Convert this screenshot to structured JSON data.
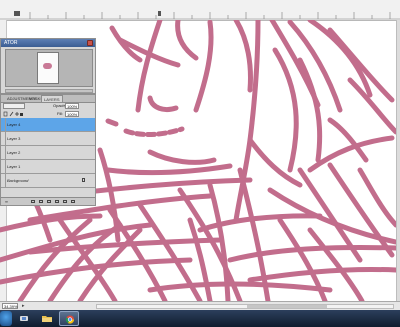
{
  "navigator": {
    "title": "ATOR"
  },
  "layers_panel": {
    "tabs": [
      "ADJUSTMENTS",
      "MASKS",
      "LAYERS"
    ],
    "opacity_label": "Opacity:",
    "opacity_value": "100%",
    "fill_label": "Fill:",
    "fill_value": "100%",
    "layers": [
      {
        "name": "Layer 4",
        "selected": true
      },
      {
        "name": "Layer 3",
        "selected": false
      },
      {
        "name": "Layer 2",
        "selected": false
      },
      {
        "name": "Layer 1",
        "selected": false
      },
      {
        "name": "Background",
        "selected": false,
        "locked": true
      }
    ],
    "footer_link": "∞"
  },
  "status_bar": {
    "zoom": "34.39%"
  },
  "colors": {
    "stroke": "#c26d8c",
    "selected_layer": "#5da5e8"
  },
  "taskbar": {
    "icons": [
      "windows-start-icon",
      "network-share-icon",
      "explorer-folder-icon",
      "chrome-icon"
    ]
  }
}
